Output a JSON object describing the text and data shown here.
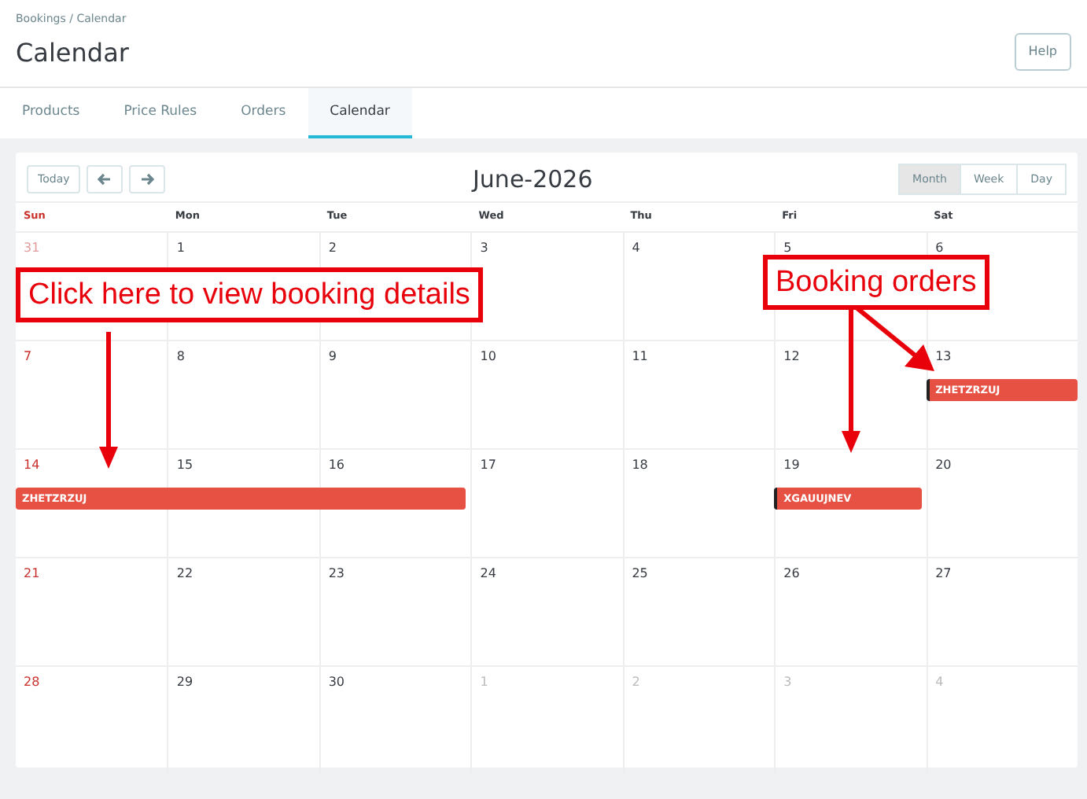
{
  "breadcrumb": [
    "Bookings",
    "Calendar"
  ],
  "breadcrumb_separator": "/",
  "page_title": "Calendar",
  "help_button": "Help",
  "tabs": [
    {
      "label": "Products",
      "selected": false
    },
    {
      "label": "Price Rules",
      "selected": false
    },
    {
      "label": "Orders",
      "selected": false
    },
    {
      "label": "Calendar",
      "selected": true
    }
  ],
  "calendar": {
    "today_button": "Today",
    "title": "June-2026",
    "views": [
      {
        "label": "Month",
        "selected": true
      },
      {
        "label": "Week",
        "selected": false
      },
      {
        "label": "Day",
        "selected": false
      }
    ],
    "weekdays": [
      "Sun",
      "Mon",
      "Tue",
      "Wed",
      "Thu",
      "Fri",
      "Sat"
    ],
    "weeks": [
      {
        "days": [
          {
            "n": "31",
            "other_month": true
          },
          {
            "n": "1",
            "other_month": false
          },
          {
            "n": "2",
            "other_month": false
          },
          {
            "n": "3",
            "other_month": false
          },
          {
            "n": "4",
            "other_month": false
          },
          {
            "n": "5",
            "other_month": false
          },
          {
            "n": "6",
            "other_month": false
          }
        ]
      },
      {
        "days": [
          {
            "n": "7",
            "other_month": false
          },
          {
            "n": "8",
            "other_month": false
          },
          {
            "n": "9",
            "other_month": false
          },
          {
            "n": "10",
            "other_month": false
          },
          {
            "n": "11",
            "other_month": false
          },
          {
            "n": "12",
            "other_month": false
          },
          {
            "n": "13",
            "other_month": false,
            "event": {
              "title": "ZHETZRZUJ",
              "flagged": true
            }
          }
        ]
      },
      {
        "days": [
          {
            "n": "14",
            "other_month": false,
            "event": {
              "title": "ZHETZRZUJ",
              "flagged": false
            }
          },
          {
            "n": "15",
            "other_month": false,
            "event_continues": true
          },
          {
            "n": "16",
            "other_month": false,
            "event_continues": true
          },
          {
            "n": "17",
            "other_month": false
          },
          {
            "n": "18",
            "other_month": false
          },
          {
            "n": "19",
            "other_month": false,
            "event": {
              "title": "XGAUUJNEV",
              "flagged": true
            }
          },
          {
            "n": "20",
            "other_month": false
          }
        ]
      },
      {
        "days": [
          {
            "n": "21",
            "other_month": false
          },
          {
            "n": "22",
            "other_month": false
          },
          {
            "n": "23",
            "other_month": false
          },
          {
            "n": "24",
            "other_month": false
          },
          {
            "n": "25",
            "other_month": false
          },
          {
            "n": "26",
            "other_month": false
          },
          {
            "n": "27",
            "other_month": false
          }
        ]
      },
      {
        "days": [
          {
            "n": "28",
            "other_month": false
          },
          {
            "n": "29",
            "other_month": false
          },
          {
            "n": "30",
            "other_month": false
          },
          {
            "n": "1",
            "other_month": true
          },
          {
            "n": "2",
            "other_month": true
          },
          {
            "n": "3",
            "other_month": true
          },
          {
            "n": "4",
            "other_month": true
          }
        ]
      }
    ]
  },
  "annotations": [
    {
      "text": "Click here to view booking details"
    },
    {
      "text": "Booking orders"
    }
  ]
}
